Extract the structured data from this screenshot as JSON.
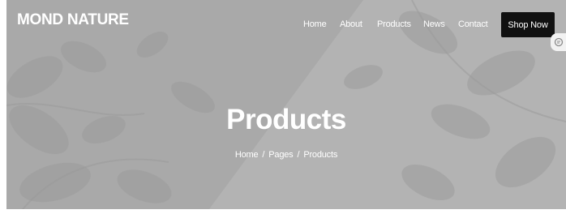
{
  "brand": {
    "name": "MOND NATURE"
  },
  "nav": {
    "items": [
      {
        "label": "Home"
      },
      {
        "label": "About"
      },
      {
        "label": "Products"
      },
      {
        "label": "News"
      },
      {
        "label": "Contact"
      }
    ],
    "cta_label": "Shop Now"
  },
  "side_tab": {
    "icon": "chat-icon"
  },
  "hero": {
    "title": "Products",
    "breadcrumb": {
      "items": [
        {
          "label": "Home"
        },
        {
          "label": "Pages"
        },
        {
          "label": "Products"
        }
      ],
      "separator": "/"
    }
  },
  "colors": {
    "hero_background": "#a9a9a9",
    "button_background": "#111111",
    "text": "#ffffff"
  }
}
